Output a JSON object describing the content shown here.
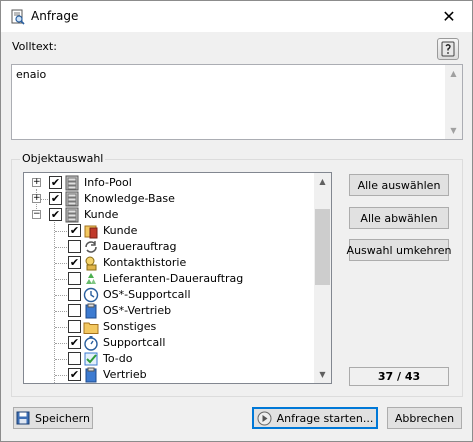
{
  "window": {
    "title": "Anfrage",
    "close_label": "✕"
  },
  "volltext": {
    "label": "Volltext:",
    "value": "enaio"
  },
  "objektauswahl": {
    "title": "Objektauswahl",
    "items": [
      {
        "label": "Info-Pool",
        "checked": true,
        "expander": "+",
        "icon": "cabinet-icon"
      },
      {
        "label": "Knowledge-Base",
        "checked": true,
        "expander": "+",
        "icon": "cabinet-icon"
      },
      {
        "label": "Kunde",
        "checked": true,
        "expander": "−",
        "icon": "cabinet-icon"
      },
      {
        "label": "Kunde",
        "checked": true,
        "icon": "folder-book-icon"
      },
      {
        "label": "Dauerauftrag",
        "checked": false,
        "icon": "recurring-arrows-icon"
      },
      {
        "label": "Kontakthistorie",
        "checked": true,
        "icon": "contact-history-icon"
      },
      {
        "label": "Lieferanten-Dauerauftrag",
        "checked": false,
        "icon": "recycle-icon"
      },
      {
        "label": "OS*-Supportcall",
        "checked": false,
        "icon": "clock-icon"
      },
      {
        "label": "OS*-Vertrieb",
        "checked": false,
        "icon": "clipboard-blue-icon"
      },
      {
        "label": "Sonstiges",
        "checked": false,
        "icon": "folder-icon"
      },
      {
        "label": "Supportcall",
        "checked": true,
        "icon": "stopwatch-icon"
      },
      {
        "label": "To-do",
        "checked": false,
        "icon": "todo-check-icon"
      },
      {
        "label": "Vertrieb",
        "checked": true,
        "icon": "clipboard-blue-icon"
      }
    ]
  },
  "buttons": {
    "select_all": "Alle auswählen",
    "deselect_all": "Alle abwählen",
    "invert": "Auswahl umkehren",
    "save": "Speichern",
    "start": "Anfrage starten...",
    "cancel": "Abbrechen"
  },
  "selection_count": "37 / 43"
}
